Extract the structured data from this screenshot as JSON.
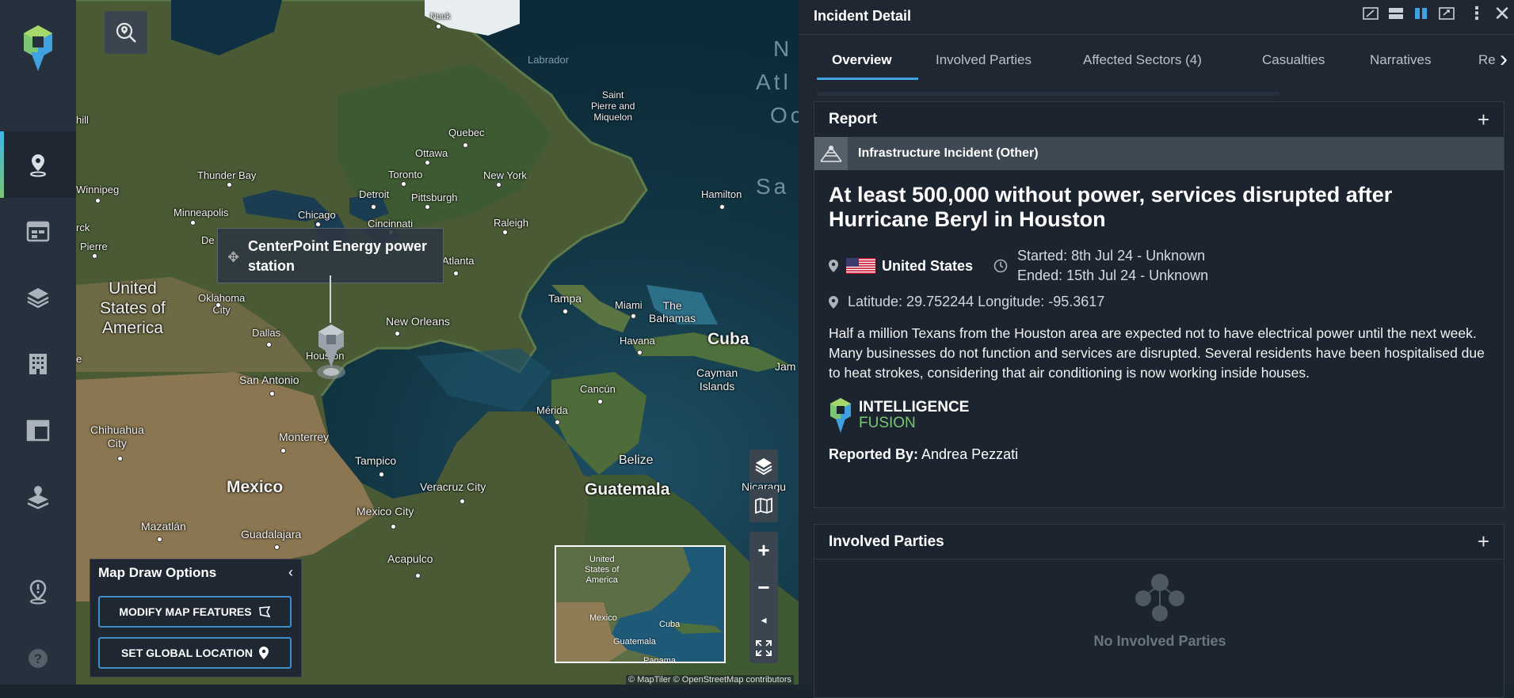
{
  "sidebar": {
    "items": [
      {
        "name": "incidents"
      },
      {
        "name": "calendar"
      },
      {
        "name": "layers"
      },
      {
        "name": "buildings"
      },
      {
        "name": "dashboard"
      },
      {
        "name": "stacked-locations"
      },
      {
        "name": "location-alert"
      },
      {
        "name": "help"
      }
    ]
  },
  "map": {
    "labels": {
      "nuuk": "Nuuk",
      "labrador": "Labrador",
      "saint_pierre": "Saint\nPierre and\nMiquelon",
      "quebec": "Quebec",
      "ottawa": "Ottawa",
      "thunder_bay": "Thunder Bay",
      "toronto": "Toronto",
      "new_york": "New York",
      "winnipeg": "Winnipeg",
      "minneapolis": "Minneapolis",
      "detroit": "Detroit",
      "pittsburgh": "Pittsburgh",
      "chicago": "Chicago",
      "cincinnati": "Cincinnati",
      "raleigh": "Raleigh",
      "hamilton": "Hamilton",
      "pierre": "Pierre",
      "atlanta": "Atlanta",
      "usa": "United\nStates of\nAmerica",
      "oklahoma": "Oklahoma\nCity",
      "dallas": "Dallas",
      "new_orleans": "New Orleans",
      "tampa": "Tampa",
      "miami": "Miami",
      "bahamas": "The\nBahamas",
      "havana": "Havana",
      "cuba": "Cuba",
      "cayman": "Cayman\nIslands",
      "jam": "Jam",
      "houston": "Houston",
      "san_antonio": "San Antonio",
      "cancun": "Cancún",
      "merida": "Mérida",
      "chihuahua": "Chihuahua\nCity",
      "monterrey": "Monterrey",
      "mexico": "Mexico",
      "tampico": "Tampico",
      "veracruz": "Veracruz City",
      "belize": "Belize",
      "guatemala": "Guatemala",
      "nicaragua": "Nicaragu",
      "mexico_city": "Mexico City",
      "mazatlan": "Mazatlán",
      "guadalajara": "Guadalajara",
      "acapulco": "Acapulco",
      "north_atlantic_1": "N",
      "north_atlantic_2": "Atl",
      "north_atlantic_3": "Oc",
      "sargasso": "Sa",
      "hill": "hill",
      "rck": "rck",
      "de": "De",
      "re": "e"
    },
    "tooltip": "CenterPoint Energy power station",
    "draw_options": {
      "title": "Map Draw Options",
      "modify_label": "MODIFY MAP FEATURES",
      "global_label": "SET GLOBAL LOCATION"
    },
    "minimap": {
      "usa": "United\nStates of\nAmerica",
      "mexico": "Mexico",
      "cuba": "Cuba",
      "guatemala": "Guatemala",
      "panama": "Panama"
    },
    "attribution": "© MapTiler © OpenStreetMap contributors"
  },
  "panel": {
    "title": "Incident Detail",
    "tabs": [
      {
        "label": "Overview",
        "active": true
      },
      {
        "label": "Involved Parties",
        "active": false
      },
      {
        "label": "Affected Sectors (4)",
        "active": false
      },
      {
        "label": "Casualties",
        "active": false
      },
      {
        "label": "Narratives",
        "active": false
      },
      {
        "label": "Re",
        "active": false
      }
    ],
    "report": {
      "heading": "Report",
      "category": "Infrastructure Incident (Other)",
      "headline": "At least 500,000 without power, services disrupted after Hurricane Beryl in Houston",
      "country": "United States",
      "started": "Started: 8th Jul 24 - Unknown",
      "ended": "Ended: 15th Jul 24 - Unknown",
      "coordinates": "Latitude: 29.752244 Longitude: -95.3617",
      "description": "Half a million Texans from the Houston area are expected not to have electrical power until the next week. Many businesses do not function and services are disrupted. Several residents have been hospitalised due to heat strokes, considering that air conditioning is now working inside houses.",
      "brand_line1": "INTELLIGENCE",
      "brand_line2": "FUSION",
      "reported_by_label": "Reported By:",
      "reported_by_name": "Andrea Pezzati"
    },
    "involved": {
      "heading": "Involved Parties",
      "empty": "No Involved Parties"
    }
  },
  "colors": {
    "accent": "#3fa1e0",
    "brand_green": "#7cc576",
    "panel_bg": "#1f2832",
    "sidebar_bg": "#27313d"
  }
}
